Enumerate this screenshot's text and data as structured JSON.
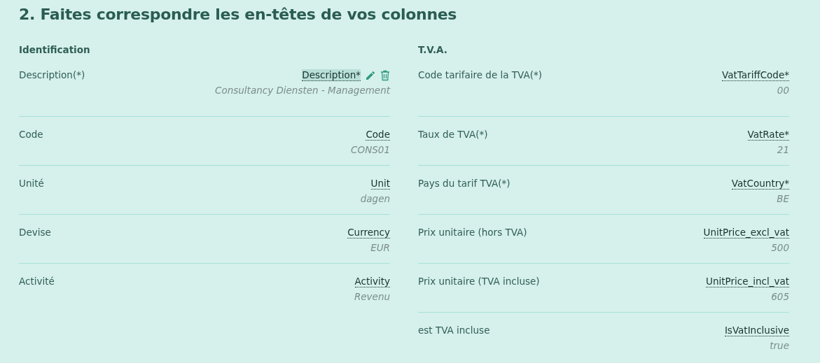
{
  "title": "2. Faites correspondre les en-têtes de vos colonnes",
  "sections": [
    {
      "heading": "Identification",
      "rows": [
        {
          "label": "Description(*)",
          "column": "Description*",
          "sample": "Consultancy Diensten - Management",
          "selected": true
        },
        {
          "label": "Code",
          "column": "Code",
          "sample": "CONS01",
          "selected": false
        },
        {
          "label": "Unité",
          "column": "Unit",
          "sample": "dagen",
          "selected": false
        },
        {
          "label": "Devise",
          "column": "Currency",
          "sample": "EUR",
          "selected": false
        },
        {
          "label": "Activité",
          "column": "Activity",
          "sample": "Revenu",
          "selected": false
        }
      ]
    },
    {
      "heading": "T.V.A.",
      "rows": [
        {
          "label": "Code tarifaire de la TVA(*)",
          "column": "VatTariffCode*",
          "sample": "00",
          "selected": false
        },
        {
          "label": "Taux de TVA(*)",
          "column": "VatRate*",
          "sample": "21",
          "selected": false
        },
        {
          "label": "Pays du tarif TVA(*)",
          "column": "VatCountry*",
          "sample": "BE",
          "selected": false
        },
        {
          "label": "Prix unitaire (hors TVA)",
          "column": "UnitPrice_excl_vat",
          "sample": "500",
          "selected": false
        },
        {
          "label": "Prix unitaire (TVA incluse)",
          "column": "UnitPrice_incl_vat",
          "sample": "605",
          "selected": false
        },
        {
          "label": "est TVA incluse",
          "column": "IsVatInclusive",
          "sample": "true",
          "selected": false
        }
      ]
    }
  ]
}
